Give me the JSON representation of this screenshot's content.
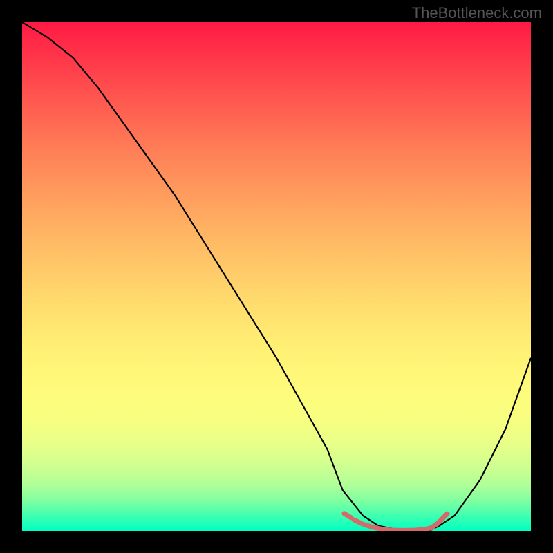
{
  "watermark": "TheBottleneck.com",
  "chart_data": {
    "type": "line",
    "title": "",
    "xlabel": "",
    "ylabel": "",
    "xlim": [
      0,
      100
    ],
    "ylim": [
      0,
      100
    ],
    "series": [
      {
        "name": "bottleneck-curve",
        "x": [
          0,
          5,
          10,
          15,
          20,
          25,
          30,
          35,
          40,
          45,
          50,
          55,
          60,
          63,
          67,
          70,
          75,
          80,
          82,
          85,
          90,
          95,
          100
        ],
        "values": [
          100,
          97,
          93,
          87,
          80,
          73,
          66,
          58,
          50,
          42,
          34,
          25,
          16,
          8,
          3,
          1,
          0,
          0,
          1,
          3,
          10,
          20,
          34
        ],
        "color": "#000000"
      },
      {
        "name": "sweet-spot-dashes",
        "x": [
          64,
          66,
          68,
          70,
          72,
          74,
          76,
          78,
          80,
          81,
          82,
          83
        ],
        "values": [
          3.0,
          1.8,
          1.0,
          0.5,
          0.2,
          0.1,
          0.1,
          0.2,
          0.5,
          1.0,
          1.8,
          2.8
        ],
        "color": "#d46a6a"
      }
    ],
    "gradient_stops": [
      {
        "pos": 0,
        "color": "#ff1a44"
      },
      {
        "pos": 50,
        "color": "#ffd468"
      },
      {
        "pos": 80,
        "color": "#f8ff80"
      },
      {
        "pos": 100,
        "color": "#00ffc0"
      }
    ]
  }
}
